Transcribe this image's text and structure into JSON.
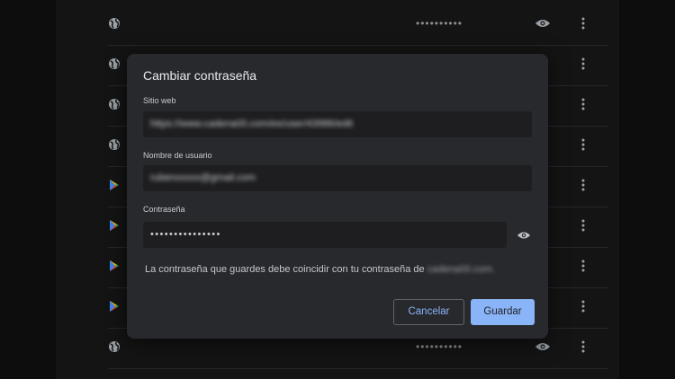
{
  "list": {
    "rows": [
      {
        "type": "web",
        "dots": "••••••••••"
      },
      {
        "type": "web",
        "dots": "••••••••••"
      },
      {
        "type": "web",
        "dots": "••••••••••"
      },
      {
        "type": "web",
        "dots": "••••••••••"
      },
      {
        "type": "play",
        "dots": "••••••••••"
      },
      {
        "type": "play",
        "dots": "••••••••••"
      },
      {
        "type": "play",
        "dots": "••••••••••"
      },
      {
        "type": "play",
        "dots": "••••••••••"
      },
      {
        "type": "web",
        "dots": "••••••••••"
      }
    ]
  },
  "dialog": {
    "title": "Cambiar contraseña",
    "site": {
      "label": "Sitio web",
      "value": "https://www.cadena00.com/es/user/43986/edit"
    },
    "username": {
      "label": "Nombre de usuario",
      "value": "rubenxxxxx@gmail.com"
    },
    "password": {
      "label": "Contraseña",
      "value": "•••••••••••••••"
    },
    "note": {
      "text": "La contraseña que guardes debe coincidir con tu contraseña de",
      "domain": "cadena00.com."
    },
    "cancel_label": "Cancelar",
    "save_label": "Guardar"
  },
  "colors": {
    "accent": "#8ab4f8",
    "dialog_bg": "#28292c",
    "field_bg": "#1e1e20"
  },
  "icons": [
    "globe-icon",
    "play-store-icon",
    "eye-icon",
    "more-vert-icon"
  ]
}
